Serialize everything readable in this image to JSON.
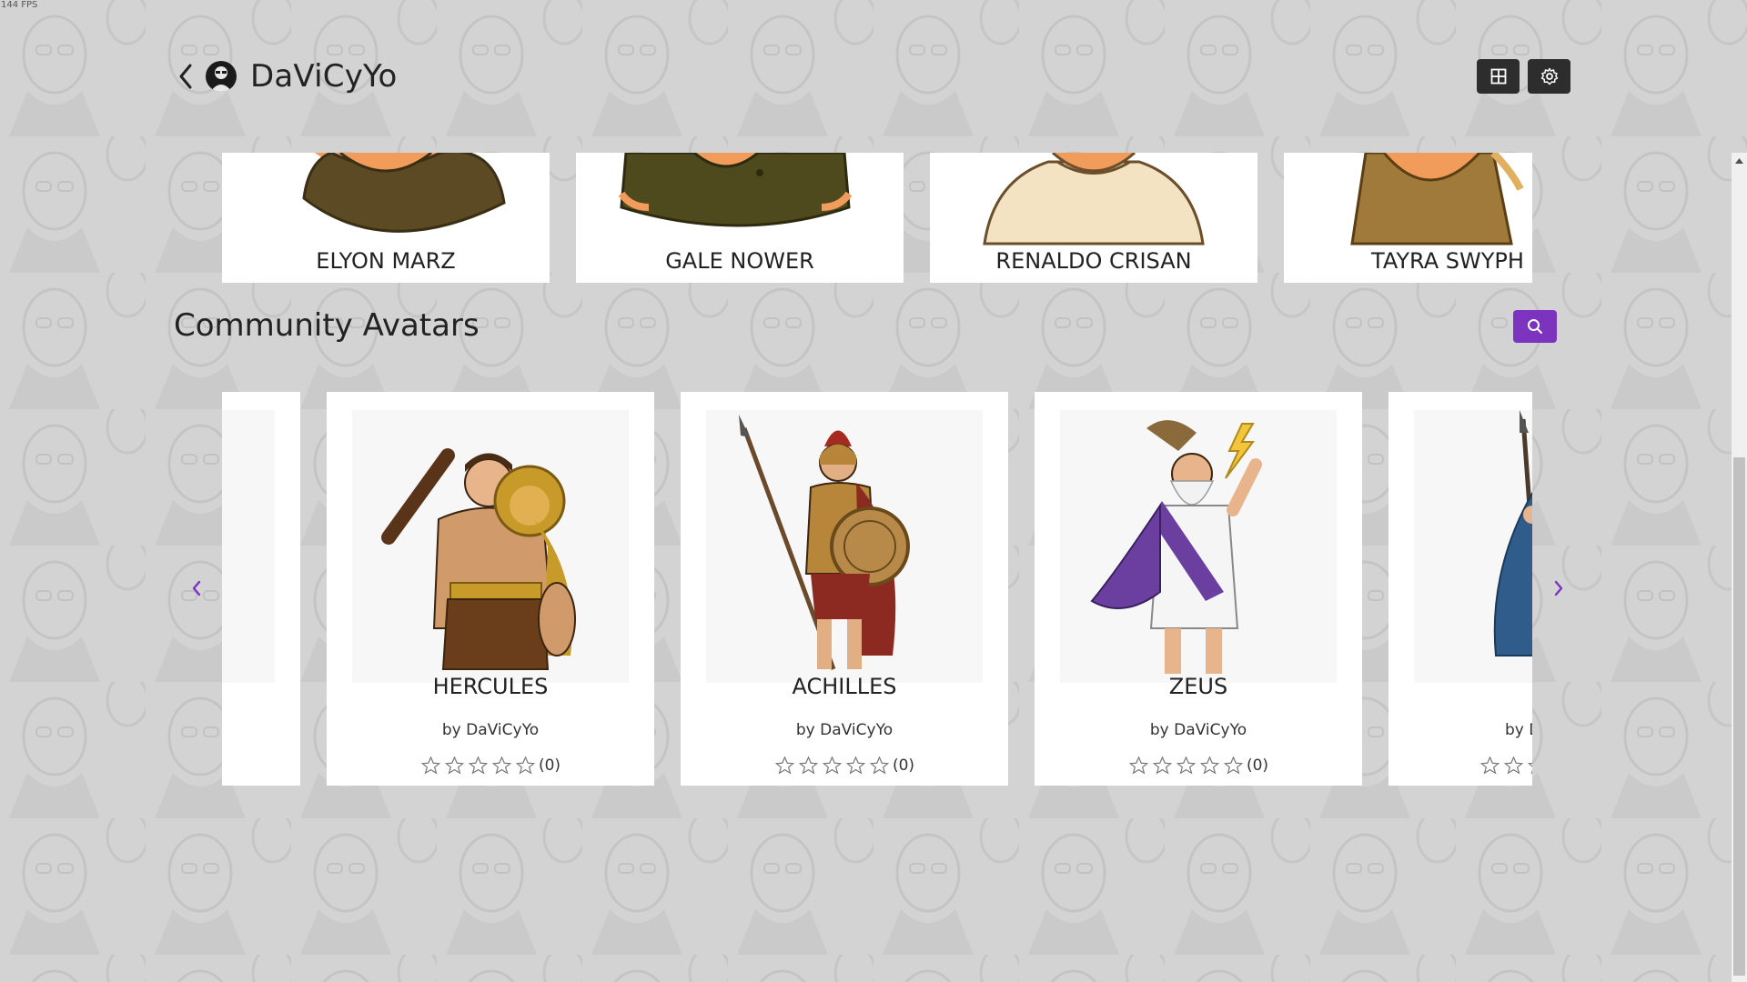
{
  "fps": "144 FPS",
  "header": {
    "title": "DaViCyYo",
    "back_icon": "chevron-left-icon",
    "avatar_icon": "user-avatar-icon"
  },
  "toolbar": {
    "layout_icon": "grid-icon",
    "settings_icon": "gear-icon"
  },
  "top_row": {
    "cards": [
      {
        "name": "ELYON MARZ",
        "shirt": "#5b4a24"
      },
      {
        "name": "GALE NOWER",
        "shirt": "#4e4a1e"
      },
      {
        "name": "RENALDO CRISAN",
        "shirt": "#f3e3c3"
      },
      {
        "name": "TAYRA SWYPH",
        "shirt": "#a07a3a"
      }
    ]
  },
  "community": {
    "title": "Community Avatars",
    "search_icon": "search-icon",
    "prev_icon": "chevron-left-icon",
    "next_icon": "chevron-right-icon",
    "cards": [
      {
        "name": "HERCULES",
        "by": "by DaViCyYo",
        "count": "(0)",
        "rating": 0,
        "accent": "#c79a2a"
      },
      {
        "name": "ACHILLES",
        "by": "by DaViCyYo",
        "count": "(0)",
        "rating": 0,
        "accent": "#8c2a22"
      },
      {
        "name": "ZEUS",
        "by": "by DaViCyYo",
        "count": "(0)",
        "rating": 0,
        "accent": "#6b3fa0"
      },
      {
        "name": "",
        "by": "by D",
        "count": "",
        "rating": 0,
        "accent": "#2f5c8a"
      }
    ]
  },
  "colors": {
    "background": "#d3d3d3",
    "button_dark": "#2d2d2d",
    "accent_purple": "#7b33c0"
  }
}
